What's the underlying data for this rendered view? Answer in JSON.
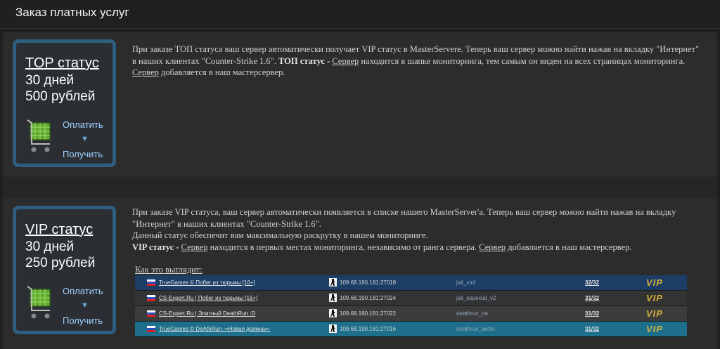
{
  "header": {
    "title": "Заказ платных услуг"
  },
  "top_service": {
    "title": "TOP статус",
    "duration": "30 дней",
    "price": "500 рублей",
    "pay_label": "Оплатить",
    "arrow": "▼",
    "get_label": "Получить",
    "desc_p1": "При заказе ТОП статуса ваш сервер автоматически получает VIP статус в MasterServere. Теперь ваш сервер можно найти нажав на вкладку \"Интернет\" в наших клиентах \"Counter-Strike 1.6\".",
    "desc_bold": "ТОП статус -",
    "desc_link1": "Сервер",
    "desc_p2": "находится в шапке мониторинга, тем самым он виден на всех страницах мониторинга.",
    "desc_link2": "Сервер",
    "desc_p3": "добавляется в наш мастерсервер."
  },
  "vip_service": {
    "title": "VIP статус",
    "duration": "30 дней",
    "price": "250 рублей",
    "pay_label": "Оплатить",
    "arrow": "▼",
    "get_label": "Получить",
    "desc_p1": "При заказе VIP статуса, ваш сервер автоматически появляется в списке нашего MasterServer'a. Теперь ваш сервер можно найти нажав на вкладку \"Интернет\" в наших клиентах \"Counter-Strike 1.6\".",
    "desc_p2": "Данный статус обеспечит вам максимальную раскрутку в нашем мониторинге.",
    "desc_bold": "VIP статус -",
    "desc_link1": "Сервер",
    "desc_p3": "находится в первых местах мониторинга, независимо от ранга сервера.",
    "desc_link2": "Сервер",
    "desc_p4": "добавляется в наш мастерсервер.",
    "example_label": "Как это выглядит:"
  },
  "servers": [
    {
      "name": "TrueGames © Побег из тюрьмы [16+]",
      "ip": "109.68.190.181:27018",
      "map": "jail_xmf",
      "players": "32/32",
      "vip": "VIP",
      "bg": "#1b3d66"
    },
    {
      "name": "CS-Expert.Ru | Побег из тюрьмы [16+]",
      "ip": "109.68.190.181:27024",
      "map": "jail_especial_v2",
      "players": "31/32",
      "vip": "VIP",
      "bg": "#333333"
    },
    {
      "name": "CS-Expert.Ru | Элитный DeathRun :D",
      "ip": "109.68.190.181:27022",
      "map": "deathrun_rio",
      "players": "31/32",
      "vip": "VIP",
      "bg": "#3c3c3c"
    },
    {
      "name": "TrueGames © DeAthRun -=Новая долина=-",
      "ip": "109.68.190.181:27016",
      "map": "deathrun_arctic",
      "players": "31/32",
      "vip": "VIP",
      "bg": "#1d6f8c"
    }
  ]
}
